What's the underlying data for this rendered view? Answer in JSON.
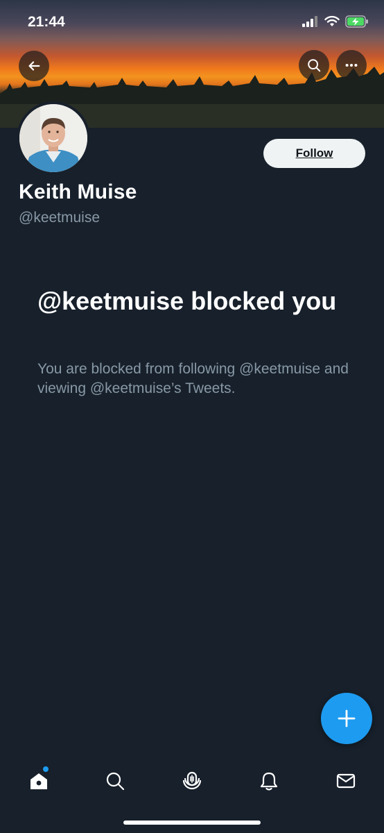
{
  "status_bar": {
    "time": "21:44"
  },
  "profile": {
    "name": "Keith Muise",
    "handle": "@keetmuise",
    "follow_label": "Follow"
  },
  "blocked": {
    "title": "@keetmuise blocked you",
    "description": "You are blocked from following @keetmuise and viewing @keetmuise’s Tweets."
  },
  "icons": {
    "back": "arrow-left-icon",
    "search": "search-icon",
    "more": "more-horizontal-icon",
    "compose": "plus-icon",
    "tabs": [
      "home-icon",
      "search-icon",
      "spaces-icon",
      "bell-icon",
      "mail-icon"
    ]
  },
  "colors": {
    "background": "#17202b",
    "accent": "#1d9bf0",
    "secondary_text": "#8899a6",
    "follow_button_bg": "#eff3f4"
  }
}
